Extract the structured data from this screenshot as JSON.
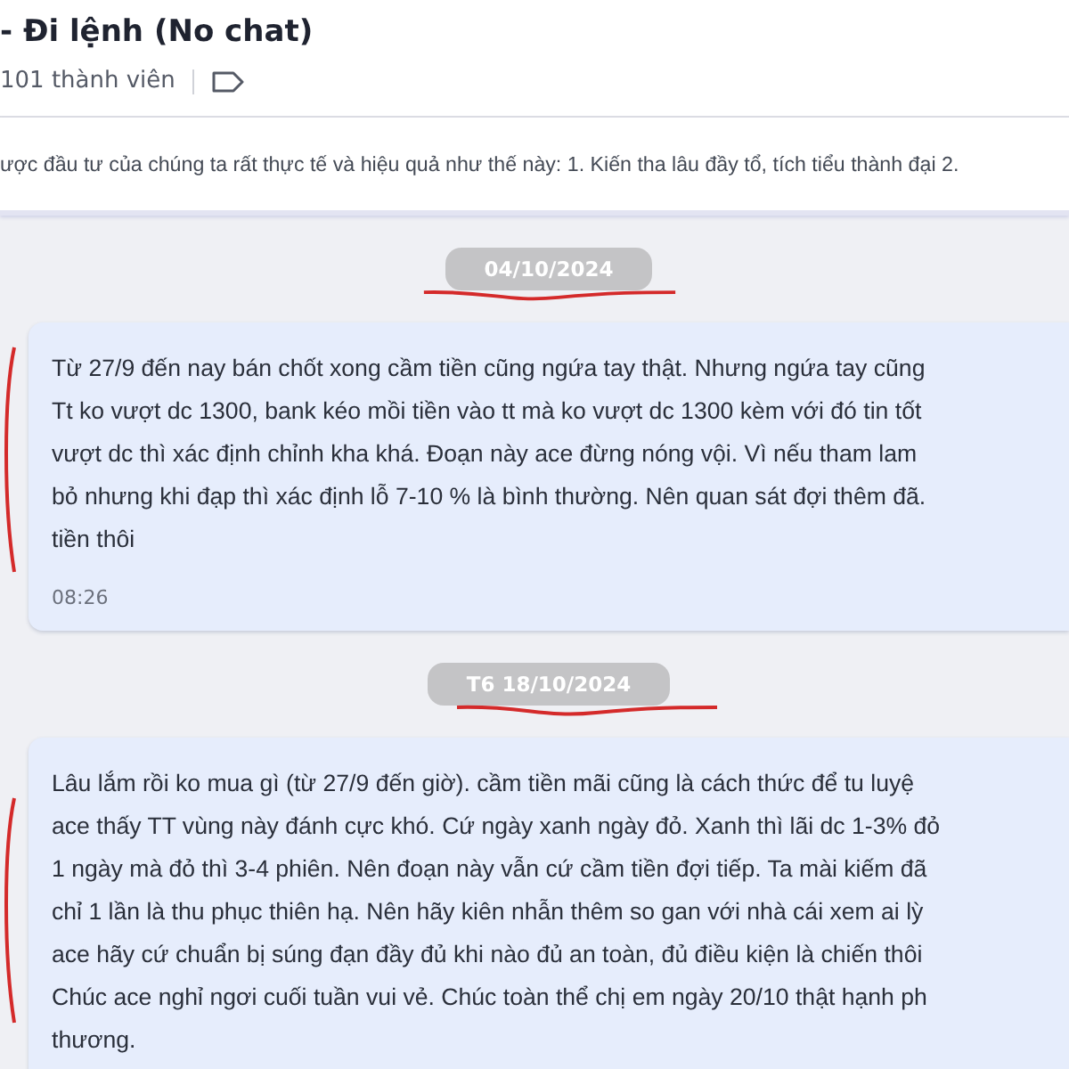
{
  "header": {
    "title": "- Đi lệnh (No chat)",
    "members": "101 thành viên"
  },
  "pinned": {
    "text": "ược đầu tư của chúng ta rất thực tế và hiệu quả như thế này: 1. Kiến tha lâu đầy tổ, tích tiểu thành đại 2."
  },
  "messages": [
    {
      "date": "04/10/2024",
      "lines": [
        "Từ 27/9 đến nay bán chốt xong cầm tiền cũng ngứa tay thật. Nhưng ngứa tay cũng",
        "Tt ko vượt dc 1300, bank kéo mồi tiền vào tt mà ko vượt dc 1300 kèm với đó tin tốt",
        "vượt dc thì xác định chỉnh kha khá. Đoạn này ace đừng nóng vội. Vì nếu tham lam",
        "bỏ nhưng khi đạp thì xác định lỗ 7-10 % là bình thường. Nên quan sát đợi thêm đã.",
        "tiền thôi"
      ],
      "time": "08:26"
    },
    {
      "date": "T6 18/10/2024",
      "lines": [
        "Lâu lắm rồi ko mua gì (từ 27/9 đến giờ). cầm tiền mãi cũng là cách thức để tu luyệ",
        "ace thấy TT vùng này đánh cực khó. Cứ ngày xanh ngày đỏ. Xanh thì lãi dc 1-3% đỏ",
        "1 ngày mà đỏ thì 3-4 phiên. Nên đoạn này vẫn cứ cầm tiền đợi tiếp. Ta mài kiếm đã",
        "chỉ 1 lần là thu phục thiên hạ. Nên hãy kiên nhẫn thêm so gan với nhà cái xem ai lỳ",
        "ace hãy cứ chuẩn bị súng đạn đầy đủ khi nào đủ an toàn, đủ điều kiện là chiến thôi",
        "Chúc ace nghỉ ngơi cuối tuần vui vẻ. Chúc toàn thể chị em ngày 20/10 thật hạnh ph",
        "thương."
      ]
    }
  ]
}
